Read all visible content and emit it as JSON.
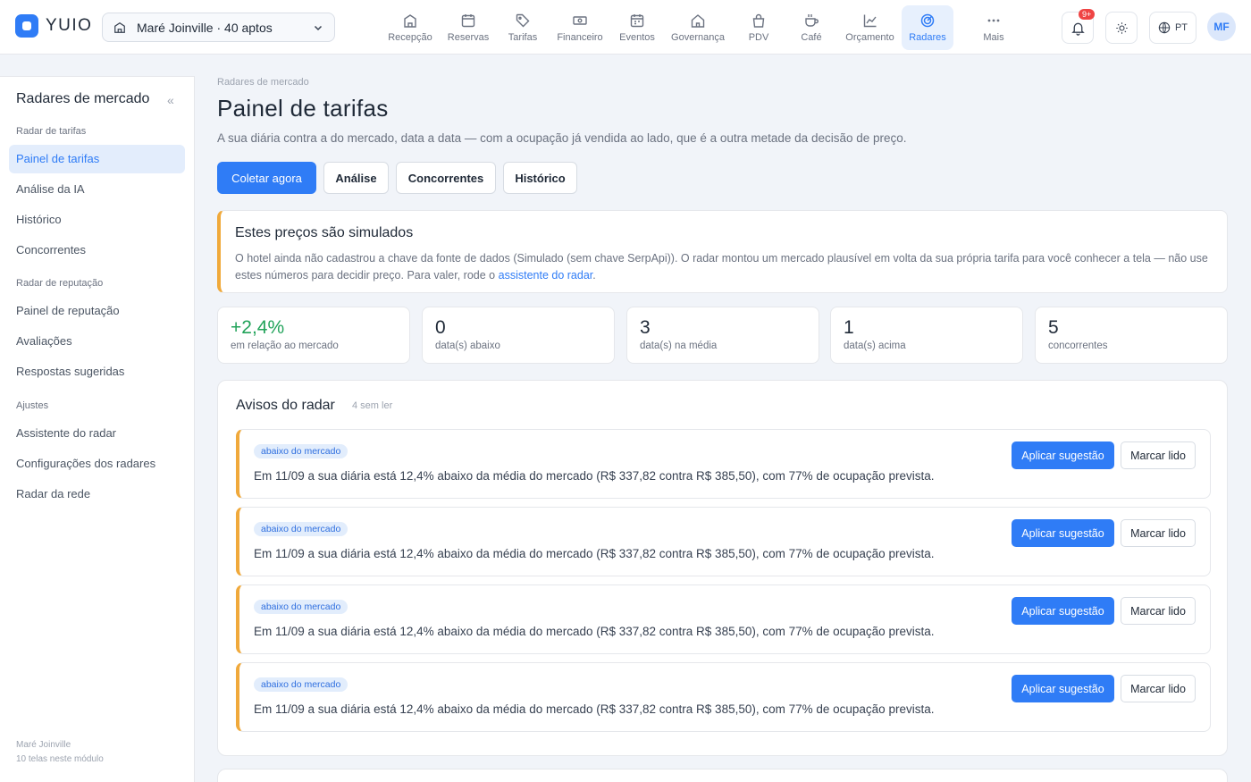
{
  "app": {
    "name": "YUIO"
  },
  "hotel_selector": {
    "label": "Maré Joinville · 40 aptos"
  },
  "nav": [
    {
      "label": "Recepção",
      "icon": "building-icon"
    },
    {
      "label": "Reservas",
      "icon": "calendar-icon"
    },
    {
      "label": "Tarifas",
      "icon": "tag-icon"
    },
    {
      "label": "Financeiro",
      "icon": "cash-icon"
    },
    {
      "label": "Eventos",
      "icon": "event-calendar-icon"
    },
    {
      "label": "Governança",
      "icon": "home-icon"
    },
    {
      "label": "PDV",
      "icon": "shopping-bag-icon"
    },
    {
      "label": "Café",
      "icon": "coffee-icon"
    },
    {
      "label": "Orçamento",
      "icon": "chart-line-icon"
    },
    {
      "label": "Radares",
      "icon": "radar-icon",
      "active": true
    },
    {
      "label": "Mais",
      "icon": "more-icon"
    }
  ],
  "topbar": {
    "notifications_badge": "9+",
    "language": "PT",
    "user_initials": "MF"
  },
  "sidebar": {
    "title": "Radares de mercado",
    "sections": [
      {
        "title": "Radar de tarifas",
        "items": [
          "Painel de tarifas",
          "Análise da IA",
          "Histórico",
          "Concorrentes"
        ]
      },
      {
        "title": "Radar de reputação",
        "items": [
          "Painel de reputação",
          "Avaliações",
          "Respostas sugeridas"
        ]
      },
      {
        "title": "Ajustes",
        "items": [
          "Assistente do radar",
          "Configurações dos radares",
          "Radar da rede"
        ]
      }
    ],
    "footer": {
      "hotel": "Maré Joinville",
      "count": "10 telas neste módulo"
    }
  },
  "page": {
    "breadcrumb": "Radares de mercado",
    "title": "Painel de tarifas",
    "subtitle": "A sua diária contra a do mercado, data a data — com a ocupação já vendida ao lado, que é a outra metade da decisão de preço.",
    "actions": [
      "Coletar agora",
      "Análise",
      "Concorrentes",
      "Histórico"
    ]
  },
  "simulated_alert": {
    "title": "Estes preços são simulados",
    "body": "O hotel ainda não cadastrou a chave da fonte de dados (Simulado (sem chave SerpApi)). O radar montou um mercado plausível em volta da sua própria tarifa para você conhecer a tela — não use estes números para decidir preço. Para valer, rode o",
    "link": "assistente do radar",
    "end": "."
  },
  "stats": [
    {
      "value": "+2,4%",
      "label": "em relação ao mercado",
      "accent": "#22a35a"
    },
    {
      "value": "0",
      "label": "data(s) abaixo"
    },
    {
      "value": "3",
      "label": "data(s) na média"
    },
    {
      "value": "1",
      "label": "data(s) acima"
    },
    {
      "value": "5",
      "label": "concorrentes"
    }
  ],
  "notices": {
    "title": "Avisos do radar",
    "unread": "4 sem ler",
    "apply_label": "Aplicar sugestão",
    "mark_label": "Marcar lido",
    "items": [
      {
        "tag": "abaixo do mercado",
        "text": "Em 11/09 a sua diária está 12,4% abaixo da média do mercado (R$ 337,82 contra R$ 385,50), com 77% de ocupação prevista."
      },
      {
        "tag": "abaixo do mercado",
        "text": "Em 11/09 a sua diária está 12,4% abaixo da média do mercado (R$ 337,82 contra R$ 385,50), com 77% de ocupação prevista."
      },
      {
        "tag": "abaixo do mercado",
        "text": "Em 11/09 a sua diária está 12,4% abaixo da média do mercado (R$ 337,82 contra R$ 385,50), com 77% de ocupação prevista."
      },
      {
        "tag": "abaixo do mercado",
        "text": "Em 11/09 a sua diária está 12,4% abaixo da média do mercado (R$ 337,82 contra R$ 385,50), com 77% de ocupação prevista."
      }
    ]
  },
  "colors": {
    "primary": "#2f7cf6",
    "warning": "#f0a93b",
    "positive": "#22a35a",
    "badge": "#ef4444"
  }
}
